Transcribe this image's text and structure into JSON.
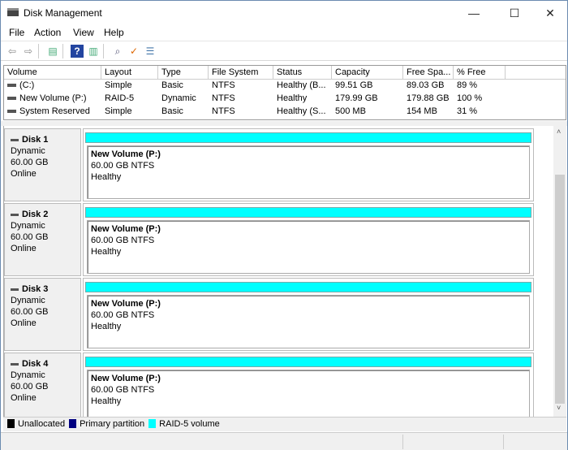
{
  "window": {
    "title": "Disk Management",
    "minimize": "—",
    "maximize": "☐",
    "close": "✕"
  },
  "menu": [
    "File",
    "Action",
    "View",
    "Help"
  ],
  "toolbar": [
    {
      "icon": "back-arrow-icon",
      "glyph": "⇦"
    },
    {
      "icon": "forward-arrow-icon",
      "glyph": "⇨"
    },
    {
      "icon": "console-tree-icon",
      "glyph": "▤"
    },
    {
      "icon": "help-icon",
      "glyph": "?"
    },
    {
      "icon": "action-pane-icon",
      "glyph": "▥"
    },
    {
      "icon": "connect-drive-icon",
      "glyph": "⌕"
    },
    {
      "icon": "checklist-icon",
      "glyph": "✓"
    },
    {
      "icon": "properties-icon",
      "glyph": "☰"
    }
  ],
  "table": {
    "headers": [
      "Volume",
      "Layout",
      "Type",
      "File System",
      "Status",
      "Capacity",
      "Free Spa...",
      "% Free"
    ],
    "rows": [
      [
        "(C:)",
        "Simple",
        "Basic",
        "NTFS",
        "Healthy (B...",
        "99.51 GB",
        "89.03 GB",
        "89 %"
      ],
      [
        "New Volume (P:)",
        "RAID-5",
        "Dynamic",
        "NTFS",
        "Healthy",
        "179.99 GB",
        "179.88 GB",
        "100 %"
      ],
      [
        "System Reserved",
        "Simple",
        "Basic",
        "NTFS",
        "Healthy (S...",
        "500 MB",
        "154 MB",
        "31 %"
      ]
    ]
  },
  "disks": [
    {
      "name": "Disk 1",
      "type": "Dynamic",
      "size": "60.00 GB",
      "state": "Online",
      "volume": "New Volume  (P:)",
      "detail": "60.00 GB NTFS",
      "health": "Healthy"
    },
    {
      "name": "Disk 2",
      "type": "Dynamic",
      "size": "60.00 GB",
      "state": "Online",
      "volume": "New Volume  (P:)",
      "detail": "60.00 GB NTFS",
      "health": "Healthy"
    },
    {
      "name": "Disk 3",
      "type": "Dynamic",
      "size": "60.00 GB",
      "state": "Online",
      "volume": "New Volume  (P:)",
      "detail": "60.00 GB NTFS",
      "health": "Healthy"
    },
    {
      "name": "Disk 4",
      "type": "Dynamic",
      "size": "60.00 GB",
      "state": "Online",
      "volume": "New Volume  (P:)",
      "detail": "60.00 GB NTFS",
      "health": "Healthy"
    }
  ],
  "legend": [
    {
      "label": "Unallocated",
      "color": "#000000"
    },
    {
      "label": "Primary partition",
      "color": "#000080"
    },
    {
      "label": "RAID-5 volume",
      "color": "#00ffff"
    }
  ]
}
